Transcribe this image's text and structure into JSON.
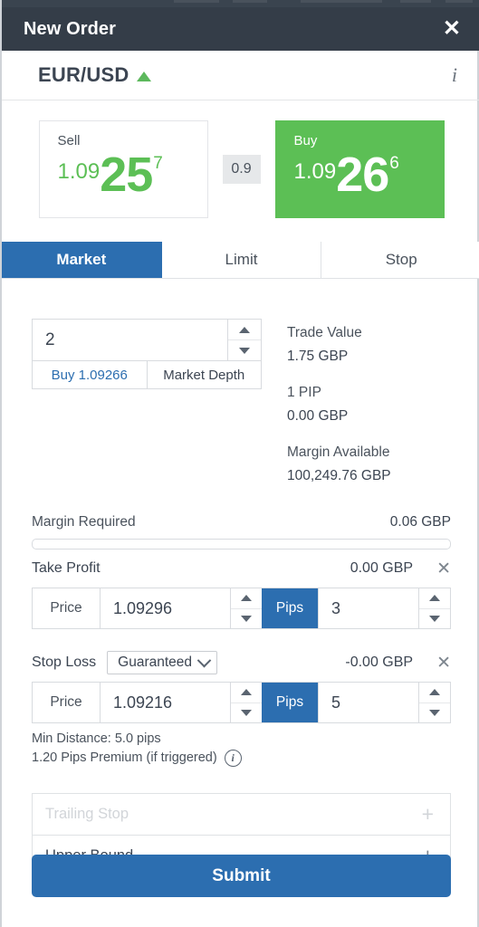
{
  "window": {
    "title": "New Order",
    "close_label": "✕"
  },
  "instrument": {
    "name": "EUR/USD",
    "direction": "up",
    "info_label": "i"
  },
  "prices": {
    "sell": {
      "label": "Sell",
      "big_prefix": "1.09",
      "big": "25",
      "sup": "7"
    },
    "buy": {
      "label": "Buy",
      "big_prefix": "1.09",
      "big": "26",
      "sup": "6"
    },
    "spread": "0.9"
  },
  "tabs": [
    {
      "label": "Market",
      "active": true
    },
    {
      "label": "Limit",
      "active": false
    },
    {
      "label": "Stop",
      "active": false
    }
  ],
  "quantity": {
    "value": "2",
    "price_link": "Buy 1.09266",
    "market_depth": "Market Depth"
  },
  "trade_info": {
    "trade_value_label": "Trade Value",
    "trade_value": "1.75 GBP",
    "pip_label": "1 PIP",
    "pip_value": "0.00 GBP",
    "margin_available_label": "Margin Available",
    "margin_available": "100,249.76 GBP"
  },
  "margin": {
    "required_label": "Margin Required",
    "required_value": "0.06 GBP",
    "progress_percent": 0
  },
  "take_profit": {
    "title": "Take Profit",
    "amount": "0.00 GBP",
    "remove_label": "✕",
    "price_label": "Price",
    "price_value": "1.09296",
    "pips_label": "Pips",
    "pips_value": "3"
  },
  "stop_loss": {
    "title": "Stop Loss",
    "type_selected": "Guaranteed",
    "amount": "-0.00 GBP",
    "remove_label": "✕",
    "price_label": "Price",
    "price_value": "1.09216",
    "pips_label": "Pips",
    "pips_value": "5",
    "note_line1": "Min Distance: 5.0 pips",
    "note_line2": "1.20 Pips Premium (if triggered)"
  },
  "add_rows": [
    {
      "label": "Trailing Stop",
      "enabled": false,
      "plus": "+"
    },
    {
      "label": "Upper Bound",
      "enabled": true,
      "plus": "+"
    }
  ],
  "submit": {
    "label": "Submit"
  },
  "colors": {
    "header_bg": "#343d48",
    "accent_blue": "#2c6eb0",
    "buy_green": "#5cbf55",
    "sell_green": "#5cbf55"
  }
}
